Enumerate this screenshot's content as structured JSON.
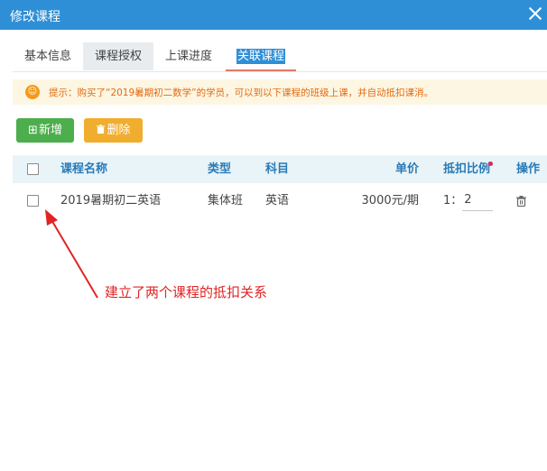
{
  "dialog": {
    "title": "修改课程"
  },
  "tabs": [
    {
      "label": "基本信息"
    },
    {
      "label": "课程授权"
    },
    {
      "label": "上课进度"
    },
    {
      "label": "关联课程"
    }
  ],
  "tip": {
    "text": "提示：购买了“2019暑期初二数学”的学员，可以到以下课程的班级上课，并自动抵扣课消。"
  },
  "toolbar": {
    "add_label": "新增",
    "delete_label": "删除"
  },
  "table": {
    "headers": {
      "name": "课程名称",
      "type": "类型",
      "subject": "科目",
      "price": "单价",
      "ratio": "抵扣比例",
      "action": "操作"
    },
    "rows": [
      {
        "name": "2019暑期初二英语",
        "type": "集体班",
        "subject": "英语",
        "price": "3000元/期",
        "ratio_prefix": "1：",
        "ratio_value": "2"
      }
    ]
  },
  "annotation": {
    "text": "建立了两个课程的抵扣关系",
    "color": "#e02424"
  },
  "colors": {
    "titlebar": "#2f8fd6",
    "add_button": "#4cae4c",
    "delete_button": "#f0ad2e",
    "tip_text": "#e26b14",
    "header_text": "#2a7ab6"
  }
}
